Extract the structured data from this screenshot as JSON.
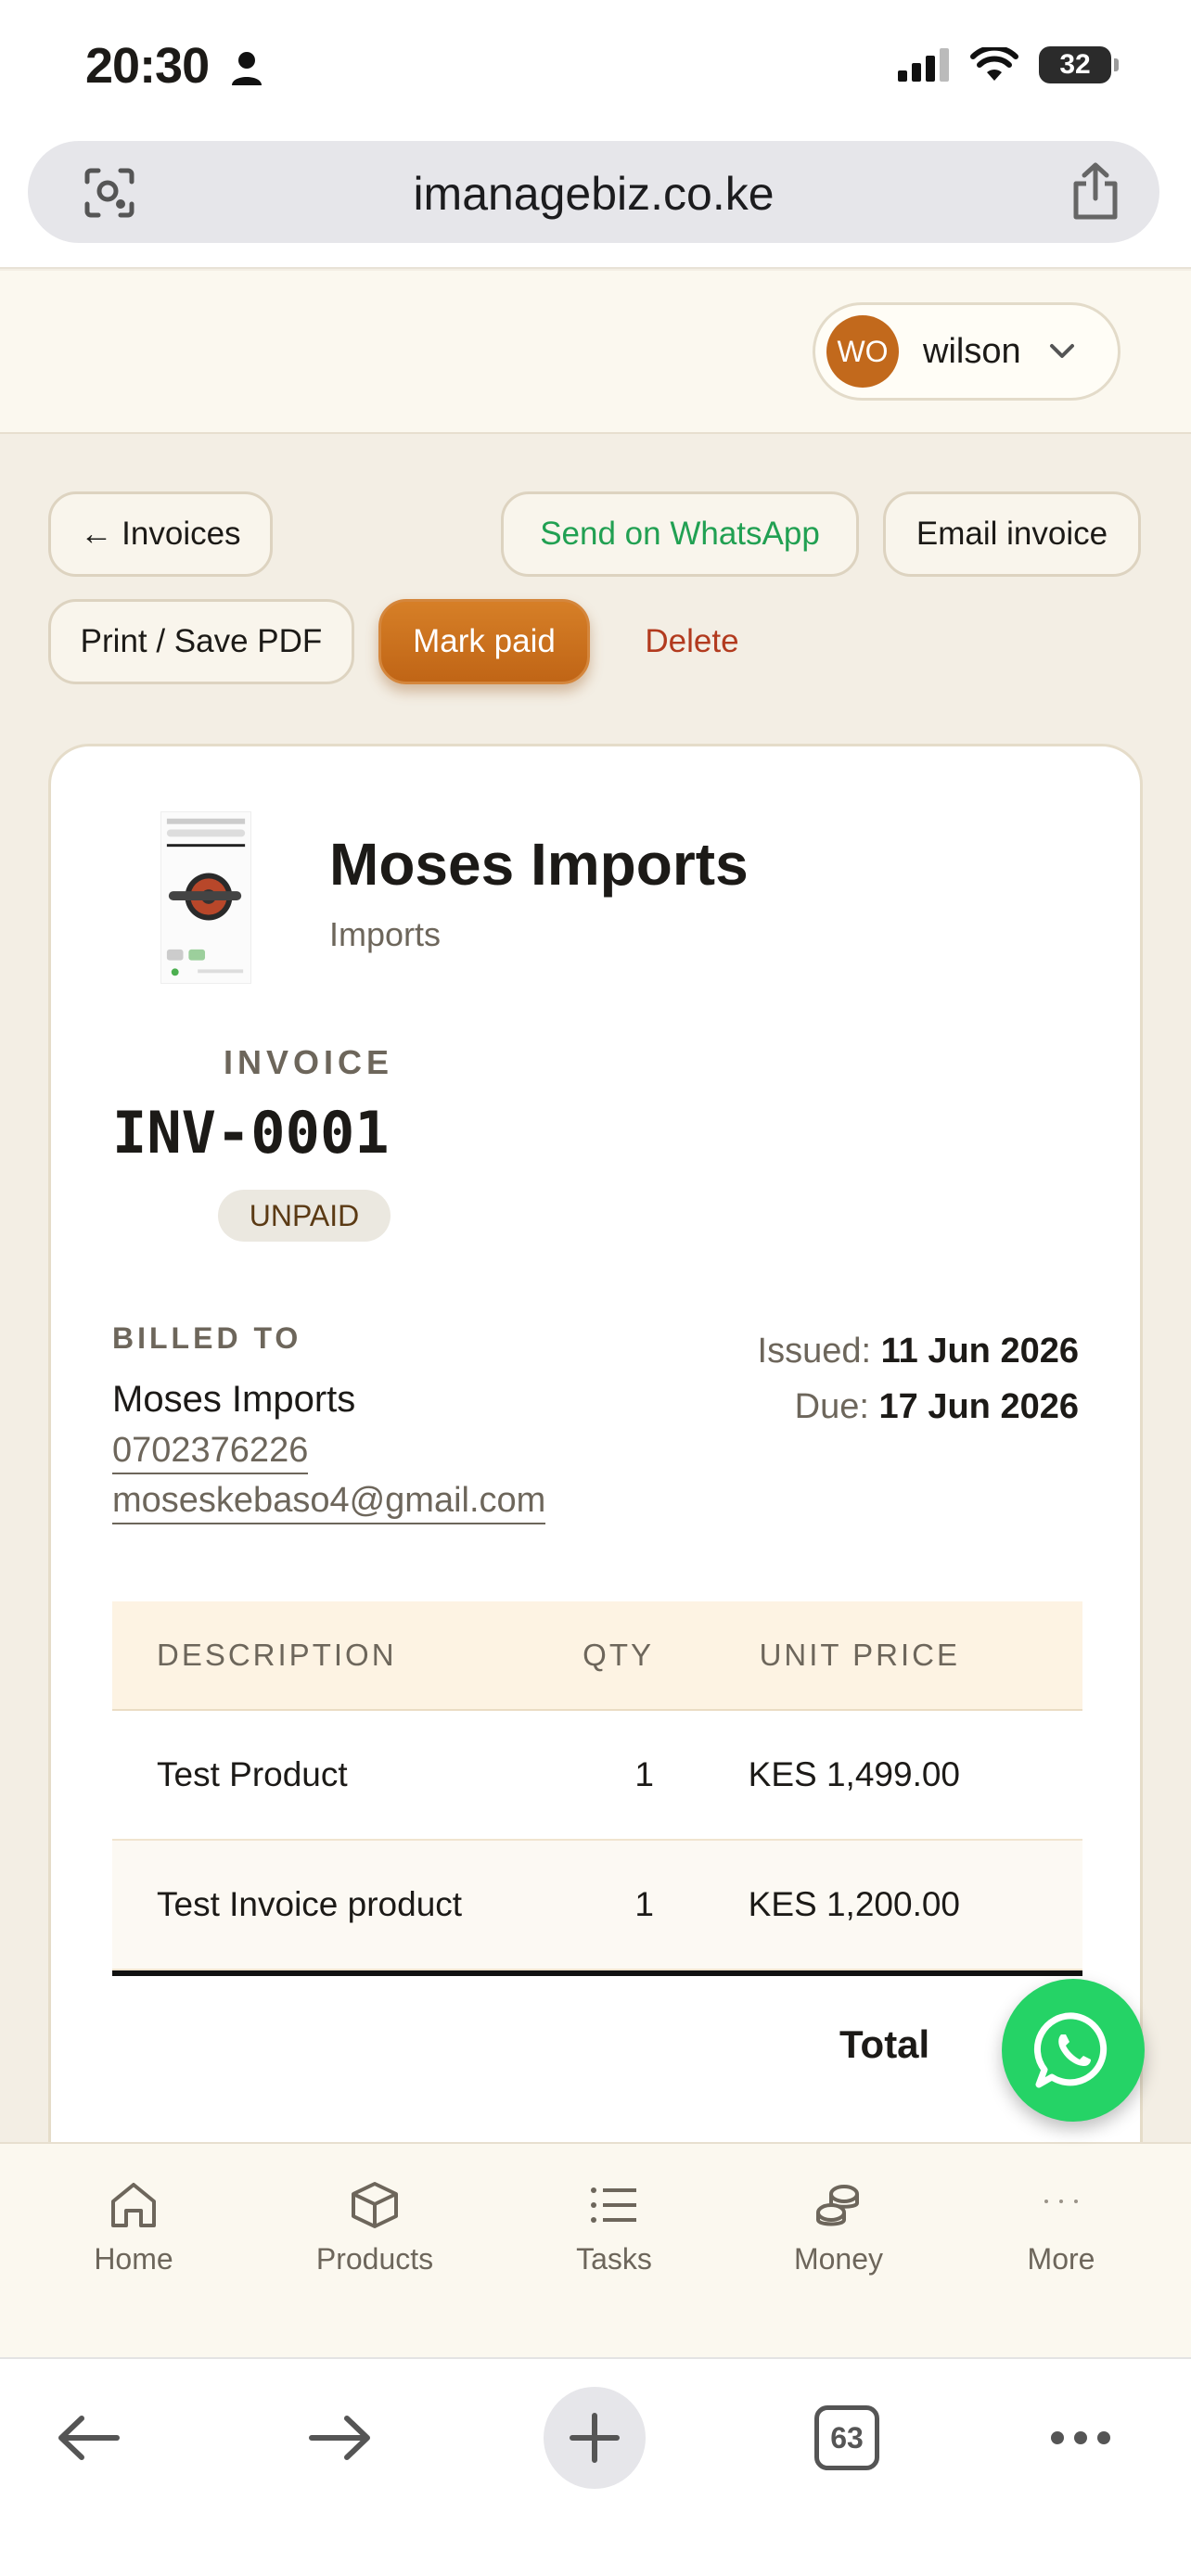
{
  "status_bar": {
    "time": "20:30",
    "battery": "32"
  },
  "browser": {
    "url": "imanagebiz.co.ke",
    "tabs_count": "63"
  },
  "header": {
    "avatar_initials": "WO",
    "user_name": "wilson"
  },
  "actions": {
    "back_label": "← Invoices",
    "whatsapp_label": "Send on WhatsApp",
    "email_label": "Email invoice",
    "print_label": "Print / Save PDF",
    "mark_paid_label": "Mark paid",
    "delete_label": "Delete"
  },
  "invoice": {
    "business_name": "Moses Imports",
    "business_sub": "Imports",
    "label": "INVOICE",
    "number": "INV-0001",
    "status": "UNPAID",
    "billed_to_label": "BILLED TO",
    "client_name": "Moses Imports",
    "client_phone": "0702376226",
    "client_email": "moseskebaso4@gmail.com",
    "issued_label": "Issued:",
    "issued_date": "11 Jun 2026",
    "due_label": "Due:",
    "due_date": "17 Jun 2026",
    "table": {
      "headers": {
        "description": "DESCRIPTION",
        "qty": "QTY",
        "unit_price": "UNIT PRICE"
      },
      "rows": [
        {
          "description": "Test Product",
          "qty": "1",
          "unit_price": "KES 1,499.00"
        },
        {
          "description": "Test Invoice product",
          "qty": "1",
          "unit_price": "KES 1,200.00"
        }
      ]
    },
    "total_label": "Total"
  },
  "nav": {
    "home": "Home",
    "products": "Products",
    "tasks": "Tasks",
    "money": "Money",
    "more": "More"
  },
  "colors": {
    "accent": "#c2691c",
    "whatsapp": "#25d366",
    "delete": "#b23a1e",
    "background": "#f3eee4"
  }
}
